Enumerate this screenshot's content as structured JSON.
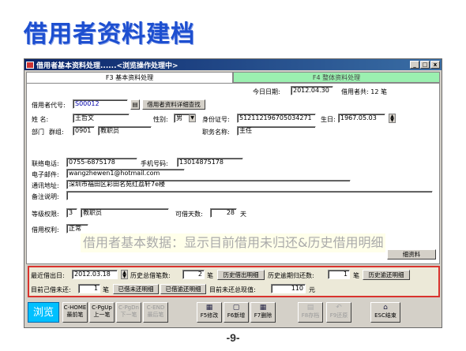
{
  "slide": {
    "title": "借用者资料建档",
    "page_number": "-9-"
  },
  "window": {
    "title": "借用者基本资料处理......<浏览操作处理中>",
    "minimize": "_",
    "maximize": "□",
    "close": "x"
  },
  "tabs": [
    {
      "label": "F3 基本资料处理"
    },
    {
      "label": "F4 整体资料处理"
    }
  ],
  "header": {
    "today_label": "今日日期:",
    "today_value": "2012.04.30",
    "count_text": "借用者共: 12 笔"
  },
  "form": {
    "borrower_code_label": "借用者代号:",
    "borrower_code_value": "S00012",
    "detail_button": "借用者资料详细查找",
    "name_label": "姓      名:",
    "name_value": "王哲文",
    "gender_label": "性别:",
    "gender_value": "男",
    "id_label": "身份证号:",
    "id_value": "512112196705034271",
    "birthday_label": "生日:",
    "birthday_value": "1967.05.03",
    "dept_label": "部门",
    "group_label": "群组:",
    "group_code": "0901",
    "group_name": "教职员",
    "position_label": "职务名称:",
    "position_value": "主任",
    "phone_label": "联络电话:",
    "phone_value": "0755-6875178",
    "mobile_label": "手机号码:",
    "mobile_value": "13014875178",
    "email_label": "电子邮件:",
    "email_value": "wangzhewen1@hotmail.com",
    "address_label": "通讯地址:",
    "address_value": "深圳市福田区彩田名苑红荔轩7e楼",
    "remark_label": "备注说明:",
    "level_label": "等级权限:",
    "level_code": "3",
    "level_name": "教职员",
    "days_label": "可借天数:",
    "days_value": "28",
    "days_unit": "天",
    "rights_label": "借用权利:",
    "rights_value": "正常",
    "overlay_text": "借用者基本数据：显示目前借用未归还&历史借用明细",
    "more_button": "细资料"
  },
  "stats": {
    "last_date_label": "最近借出日:",
    "last_date_value": "2012.03.18",
    "total_label": "历史总借笔数:",
    "total_value": "2",
    "total_unit": "笔",
    "total_btn": "历史借出明细",
    "overdue_label": "历史逾期归还数:",
    "overdue_value": "1",
    "overdue_unit": "笔",
    "overdue_btn": "历史逾还明细",
    "current_label": "目前己借未还:",
    "current_value": "1",
    "current_unit": "笔",
    "current_btn1": "已借未还明细",
    "current_btn2": "已借逾还明细",
    "value_label": "目前未还总现值:",
    "value_value": "110",
    "value_unit": "元"
  },
  "toolbar": {
    "mode": "浏览",
    "buttons": [
      {
        "label": "C-HOME 最前笔",
        "disabled": false
      },
      {
        "label": "C-PgUp 上一笔",
        "disabled": false
      },
      {
        "label": "C-PgDn 下一笔",
        "disabled": true
      },
      {
        "label": "C-END 最后笔",
        "disabled": true
      },
      {
        "label": "F5修改",
        "disabled": false,
        "icon": "edit-icon"
      },
      {
        "label": "F6新增",
        "disabled": false,
        "icon": "new-icon"
      },
      {
        "label": "F7删除",
        "disabled": false,
        "icon": "delete-icon"
      },
      {
        "label": "F8存档",
        "disabled": true,
        "icon": "save-icon"
      },
      {
        "label": "F9还原",
        "disabled": true,
        "icon": "undo-icon"
      },
      {
        "label": "ESC结束",
        "disabled": false,
        "icon": "exit-icon"
      }
    ]
  }
}
